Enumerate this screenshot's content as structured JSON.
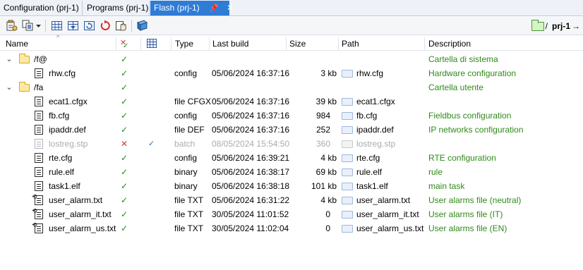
{
  "tabs": [
    {
      "label": "Configuration (prj-1)",
      "active": false
    },
    {
      "label": "Programs (prj-1)",
      "active": false
    },
    {
      "label": "Flash (prj-1)",
      "active": true,
      "pin": "📌",
      "close": "✕"
    }
  ],
  "toolbar": {
    "buttons": [
      "properties-icon",
      "copy-icon",
      "dropdown-arrow-icon",
      "grid-icon",
      "grid-download-icon",
      "refresh-icon",
      "reset-icon",
      "hand-icon",
      "book-icon"
    ],
    "project_label": "prj-1",
    "project_arrow": "→",
    "project_slash": "/"
  },
  "columns": {
    "name": "Name",
    "status": "",
    "sync": "",
    "type": "Type",
    "last_build": "Last build",
    "size": "Size",
    "path": "Path",
    "description": "Description"
  },
  "rows": [
    {
      "kind": "folder",
      "name": "/f@",
      "status": "✓",
      "description": "Cartella di sistema"
    },
    {
      "kind": "file",
      "name": "rhw.cfg",
      "status": "✓",
      "type": "config",
      "last_build": "05/06/2024 16:37:16",
      "size": "3 kb",
      "path": "rhw.cfg",
      "description": "Hardware configuration"
    },
    {
      "kind": "folder",
      "name": "/fa",
      "status": "✓",
      "description": "Cartella utente"
    },
    {
      "kind": "file",
      "name": "ecat1.cfgx",
      "status": "✓",
      "type": "file CFGX",
      "last_build": "05/06/2024 16:37:16",
      "size": "39 kb",
      "path": "ecat1.cfgx",
      "description": ""
    },
    {
      "kind": "file",
      "name": "fb.cfg",
      "status": "✓",
      "type": "config",
      "last_build": "05/06/2024 16:37:16",
      "size": "984",
      "path": "fb.cfg",
      "description": "Fieldbus configuration"
    },
    {
      "kind": "file",
      "name": "ipaddr.def",
      "status": "✓",
      "type": "file DEF",
      "last_build": "05/06/2024 16:37:16",
      "size": "252",
      "path": "ipaddr.def",
      "description": "IP networks configuration"
    },
    {
      "kind": "file",
      "name": "lostreg.stp",
      "status": "✕",
      "sync": "✓",
      "type": "batch",
      "last_build": "08/05/2024 15:54:50",
      "size": "360",
      "path": "lostreg.stp",
      "description": "",
      "disabled": true
    },
    {
      "kind": "file",
      "name": "rte.cfg",
      "status": "✓",
      "type": "config",
      "last_build": "05/06/2024 16:39:21",
      "size": "4 kb",
      "path": "rte.cfg",
      "description": "RTE configuration"
    },
    {
      "kind": "file",
      "name": "rule.elf",
      "status": "✓",
      "type": "binary",
      "last_build": "05/06/2024 16:38:17",
      "size": "69 kb",
      "path": "rule.elf",
      "description": "rule"
    },
    {
      "kind": "file",
      "name": "task1.elf",
      "status": "✓",
      "type": "binary",
      "last_build": "05/06/2024 16:38:18",
      "size": "101 kb",
      "path": "task1.elf",
      "description": "main task"
    },
    {
      "kind": "file",
      "name": "user_alarm.txt",
      "status": "✓",
      "type": "file TXT",
      "last_build": "05/06/2024 16:31:22",
      "size": "4 kb",
      "path": "user_alarm.txt",
      "description": "User alarms file (neutral)",
      "badge": "⟲"
    },
    {
      "kind": "file",
      "name": "user_alarm_it.txt",
      "status": "✓",
      "type": "file TXT",
      "last_build": "30/05/2024 11:01:52",
      "size": "0",
      "path": "user_alarm_it.txt",
      "description": "User alarms file (IT)",
      "badge": "⟲"
    },
    {
      "kind": "file",
      "name": "user_alarm_us.txt",
      "status": "✓",
      "type": "file TXT",
      "last_build": "30/05/2024 11:02:04",
      "size": "0",
      "path": "user_alarm_us.txt",
      "description": "User alarms file (EN)",
      "badge": "⟲"
    }
  ],
  "colors": {
    "active_tab": "#2e7cd6",
    "check_green": "#1f8a1f",
    "description_green": "#2f8a1a",
    "x_red": "#d83a3a",
    "disabled_gray": "#a9acb3"
  }
}
